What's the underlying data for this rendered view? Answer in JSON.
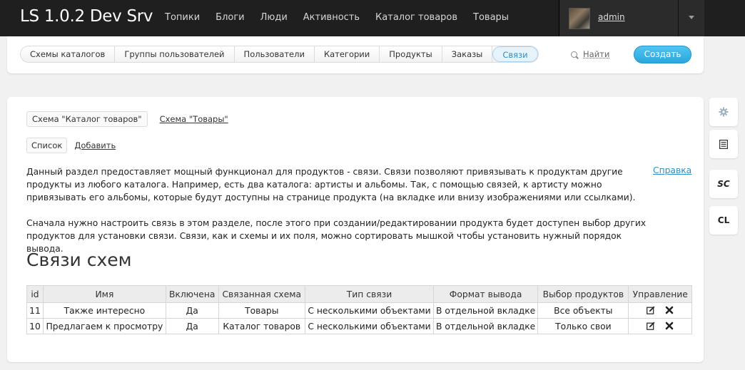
{
  "header": {
    "brand": "LS 1.0.2 Dev Srv",
    "nav": [
      "Топики",
      "Блоги",
      "Люди",
      "Активность",
      "Каталог товаров",
      "Товары"
    ],
    "user": {
      "name": "admin"
    }
  },
  "toolbar": {
    "tabs": [
      "Схемы каталогов",
      "Группы пользователей",
      "Пользователи",
      "Категории",
      "Продукты",
      "Заказы",
      "Связи"
    ],
    "active_tab": "Связи",
    "search_label": "Найти",
    "create_label": "Создать",
    "accent": "#2aa7dd"
  },
  "content": {
    "schemas": {
      "active": "Схема \"Каталог товаров\"",
      "other": "Схема \"Товары\""
    },
    "views": {
      "list": "Список",
      "add": "Добавить"
    },
    "help": "Справка",
    "paragraph1": "Данный раздел предоставляет мощный функционал для продуктов - связи. Связи позволяют привязывать к продуктам другие продукты из любого каталога. Например, есть два каталога: артисты и альбомы. Так, с помощью связей, к артисту можно привязывать его альбомы, которые будут доступны на странице продукта (на вкладке или внизу изображениями или ссылками).",
    "paragraph2": "Сначала нужно настроить связь в этом разделе, после этого при создании/редактировании продукта будет доступен выбор других продуктов для установки связи. Связи, как и схемы и их поля, можно сортировать мышкой чтобы установить нужный порядок вывода.",
    "heading": "Связи схем",
    "table": {
      "columns": [
        "id",
        "Имя",
        "Включена",
        "Связанная схема",
        "Тип связи",
        "Формат вывода",
        "Выбор продуктов",
        "Управление"
      ],
      "rows": [
        [
          "11",
          "Также интересно",
          "Да",
          "Товары",
          "С несколькими объектами",
          "В отдельной вкладке",
          "Все объекты"
        ],
        [
          "10",
          "Предлагаем к просмотру",
          "Да",
          "Каталог товаров",
          "С несколькими объектами",
          "В отдельной вкладке",
          "Только свои"
        ]
      ]
    }
  },
  "sidebar": {
    "buttons": [
      {
        "icon": "gear-icon"
      },
      {
        "icon": "list-icon"
      },
      {
        "label": "SC"
      },
      {
        "label": "CL"
      }
    ]
  }
}
